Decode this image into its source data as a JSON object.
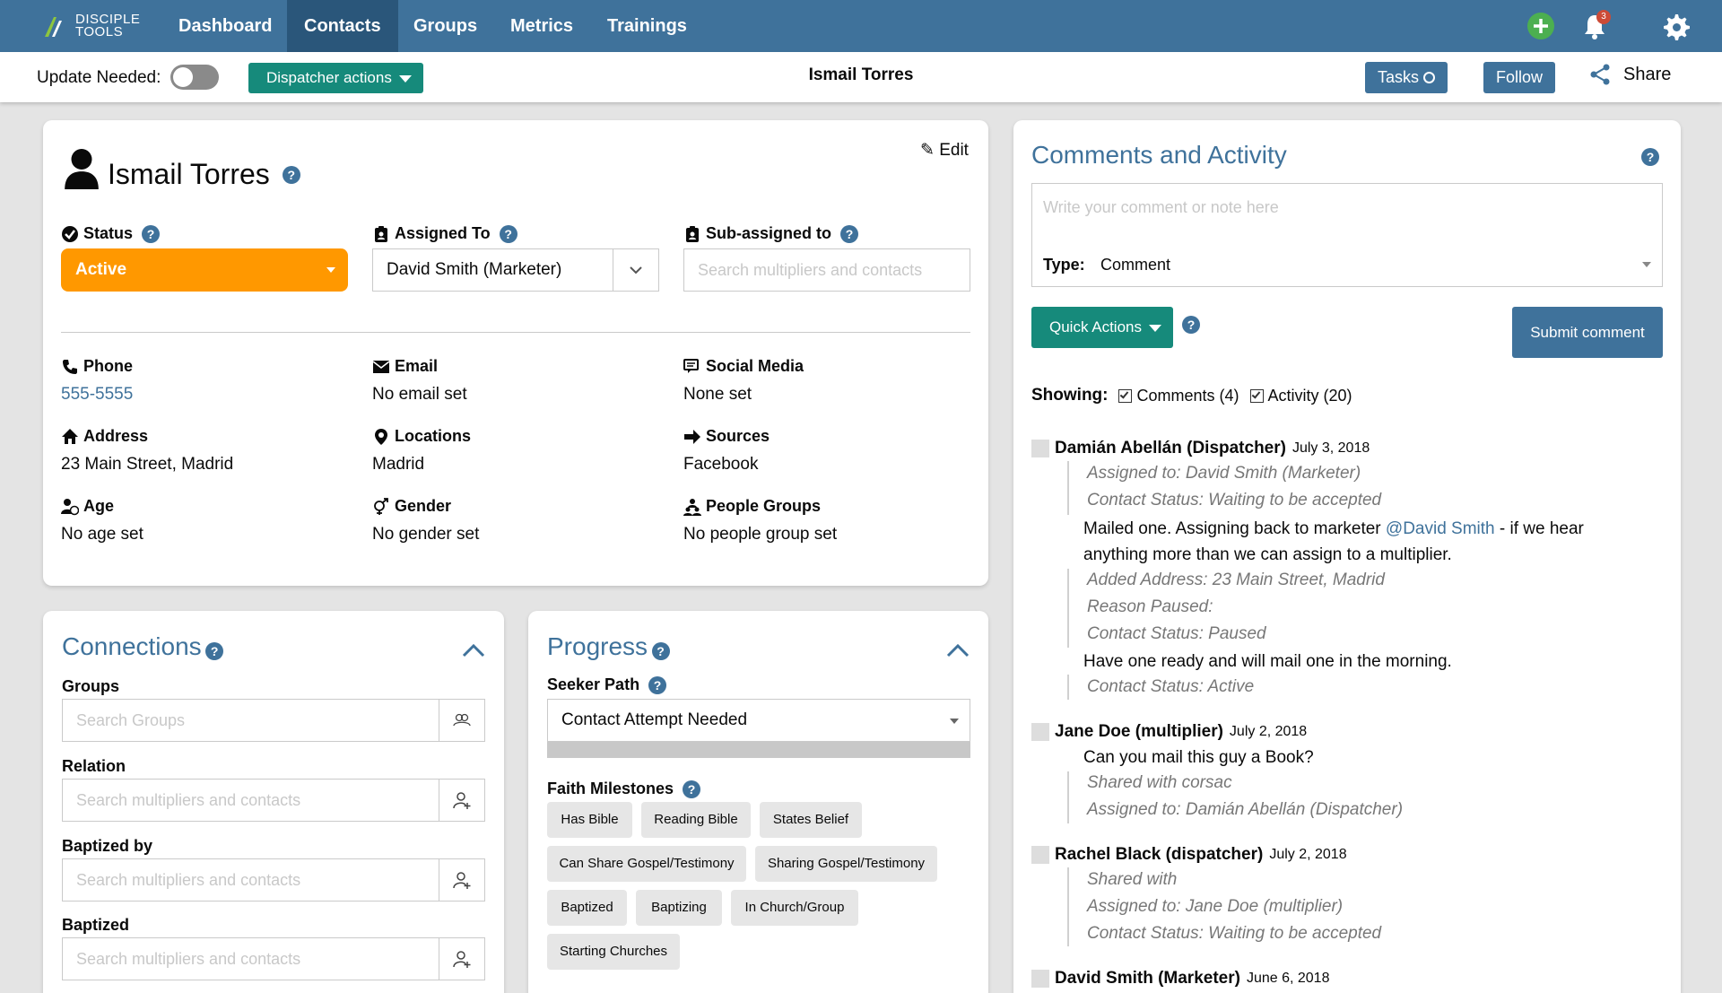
{
  "nav": {
    "logo_line1": "DISCIPLE",
    "logo_line2": "TOOLS",
    "links": [
      "Dashboard",
      "Contacts",
      "Groups",
      "Metrics",
      "Trainings"
    ],
    "active": "Contacts",
    "notification_count": "3",
    "icons": [
      "add-icon",
      "bell-icon",
      "gear-icon"
    ]
  },
  "subbar": {
    "update_needed_label": "Update Needed:",
    "dispatcher_label": "Dispatcher actions",
    "title": "Ismail Torres",
    "tasks_label": "Tasks",
    "follow_label": "Follow",
    "share_label": "Share"
  },
  "details": {
    "name": "Ismail Torres",
    "edit_label": "Edit",
    "status_label": "Status",
    "status_value": "Active",
    "assigned_label": "Assigned To",
    "assigned_value": "David Smith (Marketer)",
    "subassigned_label": "Sub-assigned to",
    "subassigned_placeholder": "Search multipliers and contacts",
    "phone_label": "Phone",
    "phone_value": "555-5555",
    "email_label": "Email",
    "email_value": "No email set",
    "social_label": "Social Media",
    "social_value": "None set",
    "address_label": "Address",
    "address_value": "23 Main Street, Madrid",
    "locations_label": "Locations",
    "locations_value": "Madrid",
    "sources_label": "Sources",
    "sources_value": "Facebook",
    "age_label": "Age",
    "age_value": "No age set",
    "gender_label": "Gender",
    "gender_value": "No gender set",
    "people_label": "People Groups",
    "people_value": "No people group set"
  },
  "connections": {
    "title": "Connections",
    "groups_label": "Groups",
    "groups_placeholder": "Search Groups",
    "relation_label": "Relation",
    "baptized_by_label": "Baptized by",
    "baptized_label": "Baptized",
    "search_placeholder": "Search multipliers and contacts"
  },
  "progress": {
    "title": "Progress",
    "seeker_label": "Seeker Path",
    "seeker_value": "Contact Attempt Needed",
    "milestones_label": "Faith Milestones",
    "milestones": [
      "Has Bible",
      "Reading Bible",
      "States Belief",
      "Can Share Gospel/Testimony",
      "Sharing Gospel/Testimony",
      "Baptized",
      "Baptizing",
      "In Church/Group",
      "Starting Churches"
    ]
  },
  "comments": {
    "title": "Comments and Activity",
    "placeholder": "Write your comment or note here",
    "type_label": "Type:",
    "type_value": "Comment",
    "quick_actions": "Quick Actions",
    "submit": "Submit comment",
    "showing_label": "Showing:",
    "filter_comments": "Comments (4)",
    "filter_activity": "Activity (20)",
    "entries": [
      {
        "author": "Damián Abellán (Dispatcher)",
        "date": "July 3, 2018",
        "lines": [
          "Assigned to: David Smith (Marketer)",
          "Contact Status: Waiting to be accepted"
        ],
        "comment_pre": "Mailed one. Assigning back to marketer ",
        "mention": "@David Smith",
        "comment_post": " - if we hear",
        "comment_line2": "anything more than we can assign to a multiplier.",
        "lines2": [
          "Added Address: 23 Main Street, Madrid",
          "Reason Paused:",
          "Contact Status: Paused"
        ],
        "comment2": "Have one ready and will mail one in the morning.",
        "lines3": [
          "Contact Status: Active"
        ]
      },
      {
        "author": "Jane Doe (multiplier)",
        "date": "July 2, 2018",
        "comment": "Can you mail this guy a Book?",
        "lines": [
          "Shared with corsac",
          "Assigned to: Damián Abellán (Dispatcher)"
        ]
      },
      {
        "author": "Rachel Black (dispatcher)",
        "date": "July 2, 2018",
        "lines": [
          "Shared with",
          "Assigned to: Jane Doe (multiplier)",
          "Contact Status: Waiting to be accepted"
        ]
      },
      {
        "author": "David Smith (Marketer)",
        "date": "June 6, 2018"
      }
    ]
  },
  "colors": {
    "primary": "#3f729b",
    "nav_active": "#2a567a",
    "teal": "#168a7b",
    "status_active": "#ff9800"
  }
}
